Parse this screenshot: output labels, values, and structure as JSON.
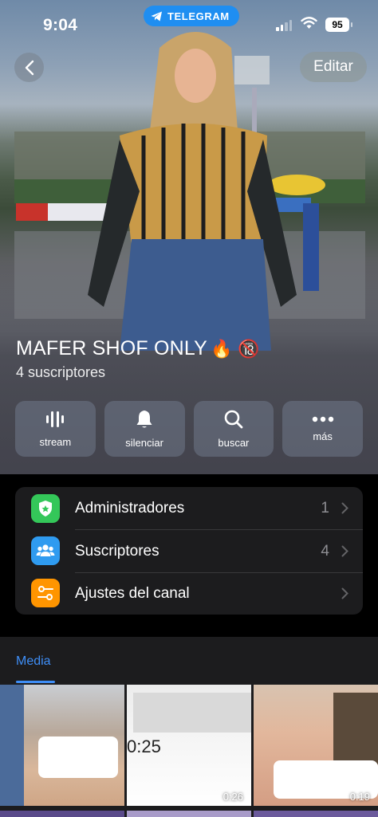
{
  "status_bar": {
    "time": "9:04",
    "app_pill": "TELEGRAM",
    "battery": "95"
  },
  "header": {
    "edit_label": "Editar"
  },
  "channel": {
    "title": "MAFER SHOF ONLY",
    "emoji": "🔥 🔞",
    "subscribers": "4 suscriptores"
  },
  "actions": [
    {
      "label": "stream",
      "icon": "stream-icon"
    },
    {
      "label": "silenciar",
      "icon": "bell-icon"
    },
    {
      "label": "buscar",
      "icon": "search-icon"
    },
    {
      "label": "más",
      "icon": "more-icon"
    }
  ],
  "info_rows": [
    {
      "label": "Administradores",
      "count": "1",
      "icon": "admin-shield-icon",
      "color": "#34c759"
    },
    {
      "label": "Suscriptores",
      "count": "4",
      "icon": "people-icon",
      "color": "#2f9bf0"
    },
    {
      "label": "Ajustes del canal",
      "count": "",
      "icon": "settings-sliders-icon",
      "color": "#ff9500"
    }
  ],
  "media": {
    "tab_label": "Media",
    "thumbs": [
      {
        "duration": ""
      },
      {
        "overlay_text": "0:25",
        "duration": "0:26"
      },
      {
        "duration": "0:19"
      }
    ]
  },
  "colors": {
    "accent": "#3e8ef7",
    "panel": "#1c1c1e",
    "telegram": "#1f8ef1"
  }
}
